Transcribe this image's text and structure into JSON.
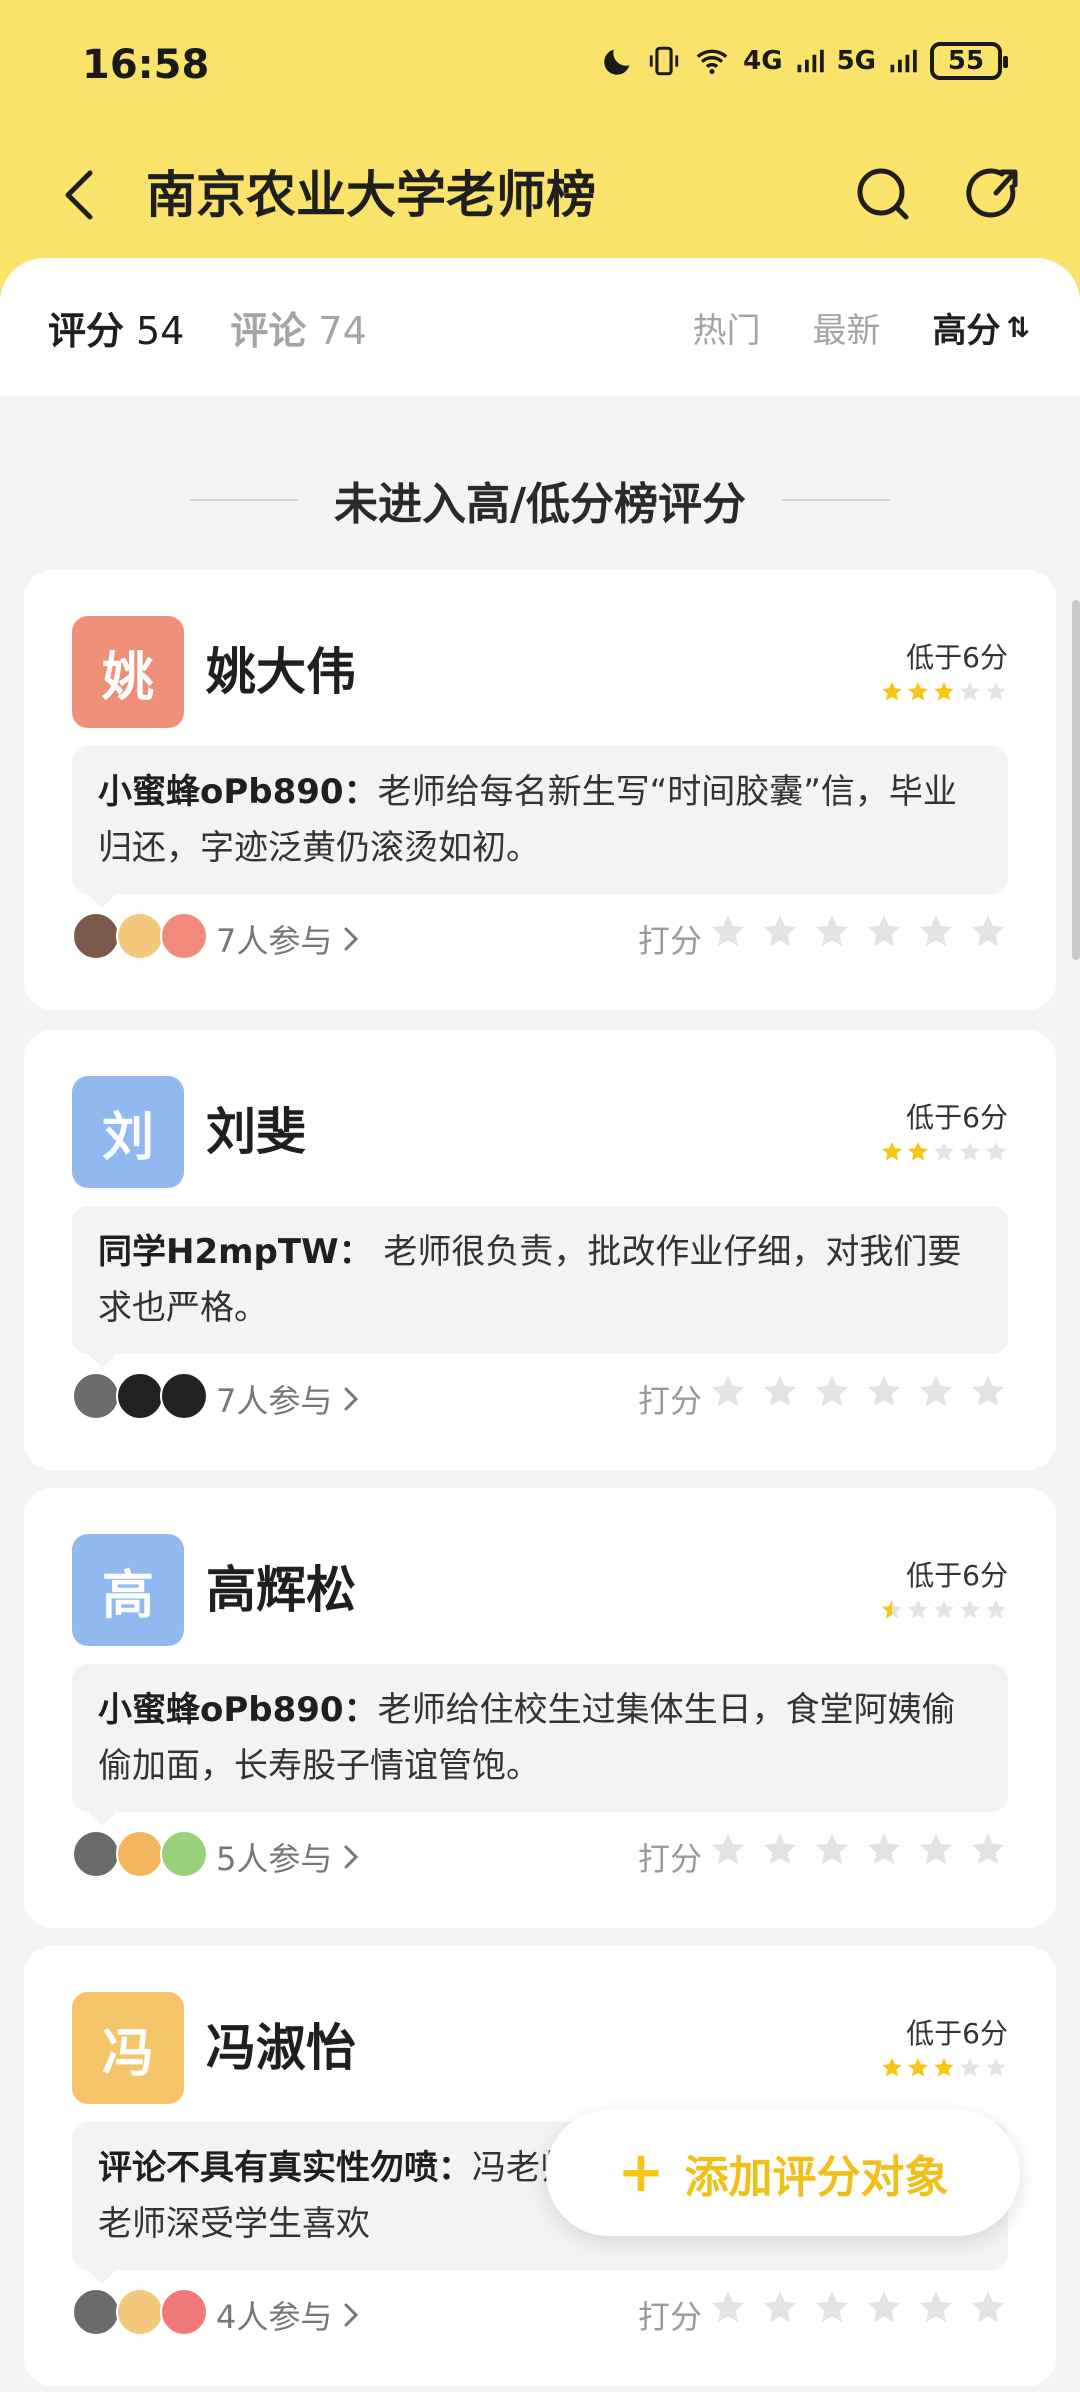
{
  "status_bar": {
    "time": "16:58",
    "net_4g": "4G",
    "net_5g": "5G",
    "battery": "55"
  },
  "header": {
    "title": "南京农业大学老师榜"
  },
  "tabs": [
    {
      "label": "评分",
      "count": "54"
    },
    {
      "label": "评论",
      "count": "74"
    }
  ],
  "sort": {
    "hot": "热门",
    "latest": "最新",
    "high": "高分",
    "high_icon": "⇅"
  },
  "section": {
    "title": "未进入高/低分榜评分"
  },
  "cards": [
    {
      "avatar_char": "姚",
      "avatar_color": "#ee8f78",
      "name": "姚大伟",
      "score_label": "低于6分",
      "stars": 3,
      "comment_author": "小蜜蜂oPb890：",
      "comment_text": "老师给每名新生写“时间胶囊”信，毕业归还，字迹泛黄仍滚烫如初。",
      "participants": "7人参与",
      "rate_label": "打分"
    },
    {
      "avatar_char": "刘",
      "avatar_color": "#92b8f0",
      "name": "刘斐",
      "score_label": "低于6分",
      "stars": 2,
      "comment_author": "同学H2mpTW：",
      "comment_text": " 老师很负责，批改作业仔细，对我们要求也严格。",
      "participants": "7人参与",
      "rate_label": "打分"
    },
    {
      "avatar_char": "高",
      "avatar_color": "#92b8f0",
      "name": "高辉松",
      "score_label": "低于6分",
      "stars": 0.5,
      "comment_author": "小蜜蜂oPb890：",
      "comment_text": "老师给住校生过集体生日，食堂阿姨偷偷加面，长寿股子情谊管饱。",
      "participants": "5人参与",
      "rate_label": "打分"
    },
    {
      "avatar_char": "冯",
      "avatar_color": "#f5c56a",
      "name": "冯淑怡",
      "score_label": "低于6分",
      "stars": 3,
      "comment_author": "评论不具有真实性勿喷：",
      "comment_text": "冯老师有口皆碑，是一位很靠谱的老师深受学生喜欢",
      "participants": "4人参与",
      "rate_label": "打分"
    }
  ],
  "fab": {
    "label": "添加评分对象"
  },
  "colors": {
    "brand_yellow": "#f9e36a",
    "star_gold": "#f5c518",
    "star_empty": "#e3e3e3"
  }
}
